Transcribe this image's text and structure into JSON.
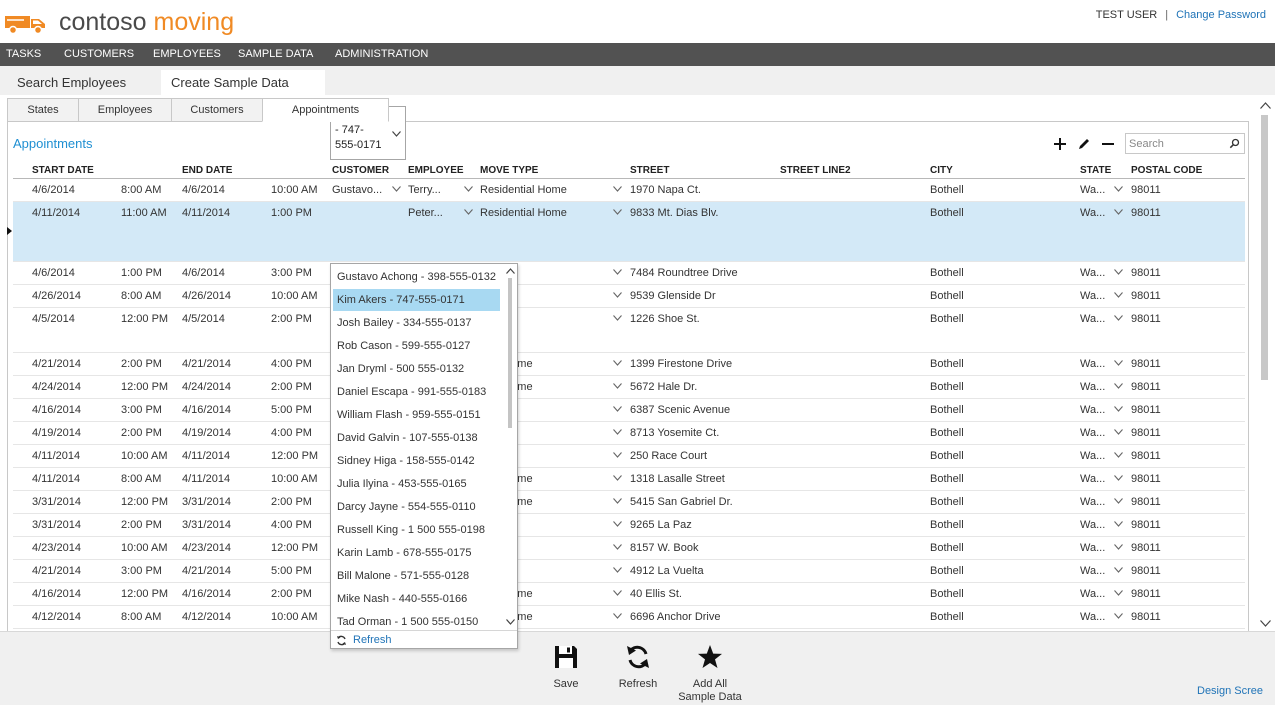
{
  "header": {
    "brand_part1": "contoso",
    "brand_part2": "moving",
    "user_name": "TEST USER",
    "separator": "|",
    "change_password": "Change Password"
  },
  "nav": {
    "items": [
      "TASKS",
      "CUSTOMERS",
      "EMPLOYEES",
      "SAMPLE DATA",
      "ADMINISTRATION"
    ]
  },
  "screen_tabs": [
    {
      "label": "Search Employees",
      "active": false
    },
    {
      "label": "Create Sample Data",
      "active": true
    }
  ],
  "sub_tabs": [
    {
      "label": "States",
      "active": false
    },
    {
      "label": "Employees",
      "active": false
    },
    {
      "label": "Customers",
      "active": false
    },
    {
      "label": "Appointments",
      "active": true
    }
  ],
  "section": {
    "title": "Appointments"
  },
  "toolbar": {
    "add_icon": "plus-icon",
    "edit_icon": "pencil-icon",
    "delete_icon": "minus-icon"
  },
  "search": {
    "placeholder": "Search",
    "value": ""
  },
  "columns": [
    "START DATE",
    "END DATE",
    "CUSTOMER",
    "EMPLOYEE",
    "MOVE TYPE",
    "STREET",
    "STREET LINE2",
    "CITY",
    "STATE",
    "POSTAL CODE"
  ],
  "rows": [
    {
      "start_date": "4/6/2014",
      "start_time": "8:00 AM",
      "end_date": "4/6/2014",
      "end_time": "10:00 AM",
      "customer": "Gustavo...",
      "employee": "Terry...",
      "move_type": "Residential Home",
      "street": "1970 Napa Ct.",
      "street2": "",
      "city": "Bothell",
      "state": "Wa...",
      "postal": "98011"
    },
    {
      "start_date": "4/11/2014",
      "start_time": "11:00 AM",
      "end_date": "4/11/2014",
      "end_time": "1:00 PM",
      "customer": "Kim Akers - 747-555-0171",
      "employee": "Peter...",
      "move_type": "Residential Home",
      "street": "9833 Mt. Dias Blv.",
      "street2": "",
      "city": "Bothell",
      "state": "Wa...",
      "postal": "98011",
      "selected": true
    },
    {
      "start_date": "4/6/2014",
      "start_time": "1:00 PM",
      "end_date": "4/6/2014",
      "end_time": "3:00 PM",
      "customer": "",
      "employee": "",
      "move_type": "s",
      "street": "7484 Roundtree Drive",
      "street2": "",
      "city": "Bothell",
      "state": "Wa...",
      "postal": "98011"
    },
    {
      "start_date": "4/26/2014",
      "start_time": "8:00 AM",
      "end_date": "4/26/2014",
      "end_time": "10:00 AM",
      "customer": "",
      "employee": "",
      "move_type": "ent",
      "street": "9539 Glenside Dr",
      "street2": "",
      "city": "Bothell",
      "state": "Wa...",
      "postal": "98011"
    },
    {
      "start_date": "4/5/2014",
      "start_time": "12:00 PM",
      "end_date": "4/5/2014",
      "end_time": "2:00 PM",
      "customer": "",
      "employee": "",
      "move_type": "ent",
      "street": "1226 Shoe St.",
      "street2": "",
      "city": "Bothell",
      "state": "Wa...",
      "postal": "98011"
    },
    {
      "start_date": "4/21/2014",
      "start_time": "2:00 PM",
      "end_date": "4/21/2014",
      "end_time": "4:00 PM",
      "customer": "",
      "employee": "",
      "move_type": "ntial Home",
      "street": "1399 Firestone Drive",
      "street2": "",
      "city": "Bothell",
      "state": "Wa...",
      "postal": "98011"
    },
    {
      "start_date": "4/24/2014",
      "start_time": "12:00 PM",
      "end_date": "4/24/2014",
      "end_time": "2:00 PM",
      "customer": "",
      "employee": "",
      "move_type": "ntial Home",
      "street": "5672 Hale Dr.",
      "street2": "",
      "city": "Bothell",
      "state": "Wa...",
      "postal": "98011"
    },
    {
      "start_date": "4/16/2014",
      "start_time": "3:00 PM",
      "end_date": "4/16/2014",
      "end_time": "5:00 PM",
      "customer": "",
      "employee": "",
      "move_type": "s",
      "street": "6387 Scenic Avenue",
      "street2": "",
      "city": "Bothell",
      "state": "Wa...",
      "postal": "98011"
    },
    {
      "start_date": "4/19/2014",
      "start_time": "2:00 PM",
      "end_date": "4/19/2014",
      "end_time": "4:00 PM",
      "customer": "",
      "employee": "",
      "move_type": "ent",
      "street": "8713 Yosemite Ct.",
      "street2": "",
      "city": "Bothell",
      "state": "Wa...",
      "postal": "98011"
    },
    {
      "start_date": "4/11/2014",
      "start_time": "10:00 AM",
      "end_date": "4/11/2014",
      "end_time": "12:00 PM",
      "customer": "",
      "employee": "",
      "move_type": "ent",
      "street": "250 Race Court",
      "street2": "",
      "city": "Bothell",
      "state": "Wa...",
      "postal": "98011"
    },
    {
      "start_date": "4/11/2014",
      "start_time": "8:00 AM",
      "end_date": "4/11/2014",
      "end_time": "10:00 AM",
      "customer": "",
      "employee": "",
      "move_type": "ntial Home",
      "street": "1318 Lasalle Street",
      "street2": "",
      "city": "Bothell",
      "state": "Wa...",
      "postal": "98011"
    },
    {
      "start_date": "3/31/2014",
      "start_time": "12:00 PM",
      "end_date": "3/31/2014",
      "end_time": "2:00 PM",
      "customer": "",
      "employee": "",
      "move_type": "ntial Home",
      "street": "5415 San Gabriel Dr.",
      "street2": "",
      "city": "Bothell",
      "state": "Wa...",
      "postal": "98011"
    },
    {
      "start_date": "3/31/2014",
      "start_time": "2:00 PM",
      "end_date": "3/31/2014",
      "end_time": "4:00 PM",
      "customer": "",
      "employee": "",
      "move_type": "s",
      "street": "9265 La Paz",
      "street2": "",
      "city": "Bothell",
      "state": "Wa...",
      "postal": "98011"
    },
    {
      "start_date": "4/23/2014",
      "start_time": "10:00 AM",
      "end_date": "4/23/2014",
      "end_time": "12:00 PM",
      "customer": "",
      "employee": "",
      "move_type": "ent",
      "street": "8157 W. Book",
      "street2": "",
      "city": "Bothell",
      "state": "Wa...",
      "postal": "98011"
    },
    {
      "start_date": "4/21/2014",
      "start_time": "3:00 PM",
      "end_date": "4/21/2014",
      "end_time": "5:00 PM",
      "customer": "",
      "employee": "",
      "move_type": "ent",
      "street": "4912 La Vuelta",
      "street2": "",
      "city": "Bothell",
      "state": "Wa...",
      "postal": "98011"
    },
    {
      "start_date": "4/16/2014",
      "start_time": "12:00 PM",
      "end_date": "4/16/2014",
      "end_time": "2:00 PM",
      "customer": "",
      "employee": "",
      "move_type": "ntial Home",
      "street": "40 Ellis St.",
      "street2": "",
      "city": "Bothell",
      "state": "Wa...",
      "postal": "98011"
    },
    {
      "start_date": "4/12/2014",
      "start_time": "8:00 AM",
      "end_date": "4/12/2014",
      "end_time": "10:00 AM",
      "customer": "",
      "employee": "",
      "move_type": "ntial Home",
      "street": "6696 Anchor Drive",
      "street2": "",
      "city": "Bothell",
      "state": "Wa...",
      "postal": "98011"
    }
  ],
  "customer_dropdown": {
    "options": [
      "Gustavo Achong - 398-555-0132",
      "Kim Akers - 747-555-0171",
      "Josh Bailey - 334-555-0137",
      "Rob Cason - 599-555-0127",
      "Jan Dryml - 500 555-0132",
      "Daniel Escapa - 991-555-0183",
      "William Flash - 959-555-0151",
      "David Galvin - 107-555-0138",
      "Sidney Higa - 158-555-0142",
      "Julia Ilyina - 453-555-0165",
      "Darcy Jayne - 554-555-0110",
      "Russell King - 1 500 555-0198",
      "Karin Lamb - 678-555-0175",
      "Bill Malone - 571-555-0128",
      "Mike Nash - 440-555-0166",
      "Tad Orman - 1 500 555-0150"
    ],
    "selected": "Kim Akers - 747-555-0171",
    "refresh_label": "Refresh"
  },
  "commands": [
    {
      "label": "Save",
      "icon": "save-icon"
    },
    {
      "label": "Refresh",
      "icon": "refresh-icon"
    },
    {
      "label": "Add All Sample Data",
      "icon": "star-icon"
    }
  ],
  "footer": {
    "design_screen": "Design Scree"
  },
  "colors": {
    "brand_orange": "#f08a24",
    "nav_bg": "#525252",
    "link_blue": "#1f73b7",
    "title_blue": "#1f8fd2",
    "selected_row": "#d3e9f7",
    "selected_option": "#a8d9f2"
  }
}
